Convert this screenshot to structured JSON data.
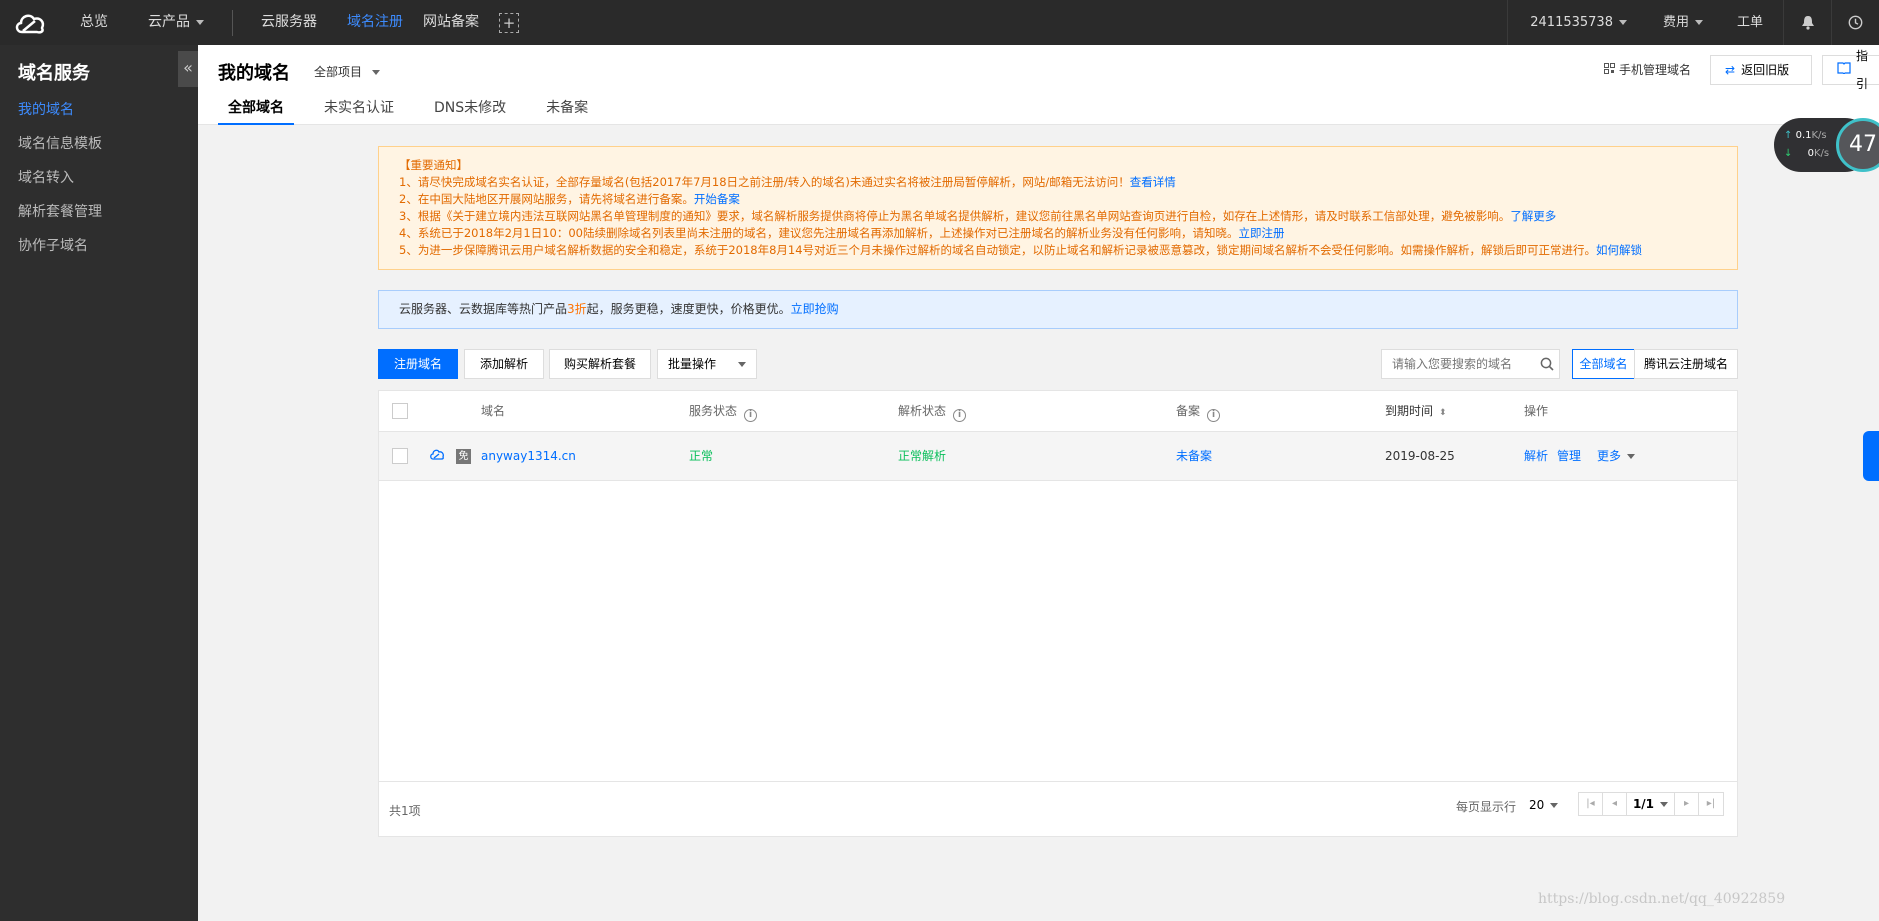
{
  "topbar": {
    "nav": [
      "总览",
      "云产品",
      "云服务器",
      "域名注册",
      "网站备案"
    ],
    "account": "2411535738",
    "billing": "费用",
    "ticket": "工单"
  },
  "sidebar": {
    "title": "域名服务",
    "items": [
      {
        "label": "我的域名",
        "active": true
      },
      {
        "label": "域名信息模板"
      },
      {
        "label": "域名转入"
      },
      {
        "label": "解析套餐管理"
      },
      {
        "label": "协作子域名"
      }
    ]
  },
  "header": {
    "title": "我的域名",
    "project": "全部项目",
    "tabs": [
      "全部域名",
      "未实名认证",
      "DNS未修改",
      "未备案"
    ],
    "mobile": "手机管理域名",
    "back_old": "返回旧版",
    "guide": "指引"
  },
  "notice": {
    "heading": "【重要通知】",
    "lines": [
      {
        "text": "1、请尽快完成域名实名认证，全部存量域名(包括2017年7月18日之前注册/转入的域名)未通过实名将被注册局暂停解析，网站/邮箱无法访问！",
        "link": "查看详情"
      },
      {
        "text": "2、在中国大陆地区开展网站服务，请先将域名进行备案。",
        "link": "开始备案"
      },
      {
        "text": "3、根据《关于建立境内违法互联网站黑名单管理制度的通知》要求，域名解析服务提供商将停止为黑名单域名提供解析，建议您前往黑名单网站查询页进行自检，如存在上述情形，请及时联系工信部处理，避免被影响。",
        "link": "了解更多"
      },
      {
        "text": "4、系统已于2018年2月1日10：00陆续删除域名列表里尚未注册的域名，建议您先注册域名再添加解析，上述操作对已注册域名的解析业务没有任何影响，请知晓。",
        "link": "立即注册"
      },
      {
        "text": "5、为进一步保障腾讯云用户域名解析数据的安全和稳定，系统于2018年8月14号对近三个月未操作过解析的域名自动锁定，以防止域名和解析记录被恶意篡改，锁定期间域名解析不会受任何影响。如需操作解析，解锁后即可正常进行。",
        "link": "如何解锁"
      }
    ]
  },
  "promo": {
    "before": "云服务器、云数据库等热门产品",
    "highlight": "3折",
    "after": "起，服务更稳，速度更快，价格更优。",
    "link": "立即抢购"
  },
  "toolbar": {
    "register": "注册域名",
    "add_resolve": "添加解析",
    "buy_package": "购买解析套餐",
    "batch": "批量操作",
    "search_placeholder": "请输入您要搜索的域名",
    "filter_all": "全部域名",
    "filter_tencent": "腾讯云注册域名"
  },
  "table": {
    "columns": [
      "域名",
      "服务状态",
      "解析状态",
      "备案",
      "到期时间",
      "操作"
    ],
    "rows": [
      {
        "domain": "anyway1314.cn",
        "badge": "免",
        "service_status": "正常",
        "resolve_status": "正常解析",
        "icp": "未备案",
        "expiry": "2019-08-25",
        "actions": [
          "解析",
          "管理",
          "更多"
        ]
      }
    ],
    "total": "共1项",
    "page_size_label": "每页显示行",
    "page_size": "20",
    "page": "1/1"
  },
  "speed": {
    "up": "0.1",
    "down": "0",
    "unit": "K/s",
    "percent": "47"
  },
  "watermark": "https://blog.csdn.net/qq_40922859",
  "colors": {
    "accent": "#006eff",
    "ok": "#0abf5b",
    "warn": "#e26a00",
    "topbar": "#2a2a2a"
  }
}
